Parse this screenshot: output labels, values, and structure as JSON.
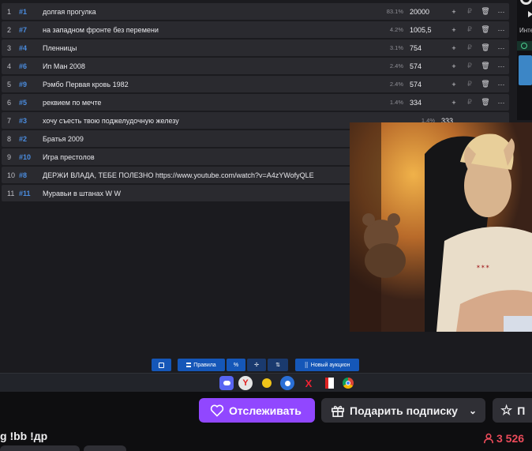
{
  "auction": {
    "rows": [
      {
        "index": "1",
        "hash": "#1",
        "name": "долгая прогулка",
        "percent": "83.1%",
        "amount": "20000",
        "plus": "+",
        "currency": "₽"
      },
      {
        "index": "2",
        "hash": "#7",
        "name": "на западном фронте без перемени",
        "percent": "4.2%",
        "amount": "1005,5",
        "plus": "+",
        "currency": "₽"
      },
      {
        "index": "3",
        "hash": "#4",
        "name": "Пленницы",
        "percent": "3.1%",
        "amount": "754",
        "plus": "+",
        "currency": "₽"
      },
      {
        "index": "4",
        "hash": "#6",
        "name": "Ип Ман 2008",
        "percent": "2.4%",
        "amount": "574",
        "plus": "+",
        "currency": "₽"
      },
      {
        "index": "5",
        "hash": "#9",
        "name": "Рэмбо Первая кровь 1982",
        "percent": "2.4%",
        "amount": "574",
        "plus": "+",
        "currency": "₽"
      },
      {
        "index": "6",
        "hash": "#5",
        "name": "реквием по мечте",
        "percent": "1.4%",
        "amount": "334",
        "plus": "+",
        "currency": "₽"
      },
      {
        "index": "7",
        "hash": "#3",
        "name": "хочу съесть твою поджелудочную железу",
        "percent": "1.4%",
        "amount": "333",
        "plus": "",
        "currency": ""
      },
      {
        "index": "8",
        "hash": "#2",
        "name": "Братья 2009",
        "percent": "",
        "amount": "",
        "plus": "",
        "currency": ""
      },
      {
        "index": "9",
        "hash": "#10",
        "name": "Игра престолов",
        "percent": "",
        "amount": "",
        "plus": "",
        "currency": ""
      },
      {
        "index": "10",
        "hash": "#8",
        "name": "ДЕРЖИ ВЛАДА, ТЕБЕ ПОЛЕЗНО https://www.youtube.com/watch?v=A4zYWofyQLE",
        "percent": "",
        "amount": "",
        "plus": "",
        "currency": ""
      },
      {
        "index": "11",
        "hash": "#11",
        "name": "Муравьи в штанах W W",
        "percent": "",
        "amount": "",
        "plus": "",
        "currency": ""
      }
    ]
  },
  "right_panel": {
    "label": "Инте"
  },
  "toolbar": {
    "rules_label": "Правила",
    "percent_label": "%",
    "new_auction_label": "Новый аукцион"
  },
  "taskbar": {
    "apps": [
      "discord-icon",
      "yandex-browser-icon",
      "app-icon",
      "chat-app-icon",
      "x-app-icon",
      "pdf-icon",
      "chrome-icon"
    ]
  },
  "twitch": {
    "follow_label": "Отслеживать",
    "gift_label": "Подарить подписку",
    "star_label": "П",
    "stream_title": "g !bb !др",
    "viewers": "3 526"
  },
  "colors": {
    "accent_purple": "#9147ff",
    "toolbar_blue": "#1557b8",
    "viewer_red": "#eb4b5a",
    "hash_blue": "#4b8de0"
  }
}
